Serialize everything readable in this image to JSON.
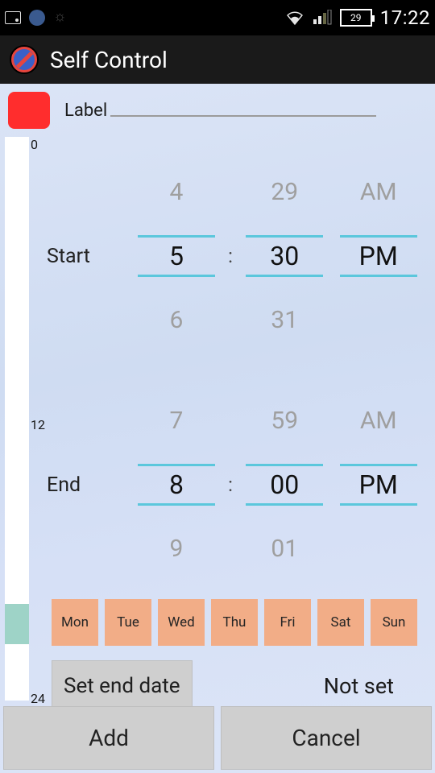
{
  "statusbar": {
    "battery": "29",
    "time": "17:22"
  },
  "appbar": {
    "title": "Self Control"
  },
  "label": {
    "title": "Label"
  },
  "timeline": {
    "ticks": {
      "top": "0",
      "mid": "12",
      "bottom": "24"
    }
  },
  "picker": {
    "start": {
      "label": "Start",
      "hour_prev": "4",
      "minute_prev": "29",
      "ampm_prev": "AM",
      "hour": "5",
      "minute": "30",
      "ampm": "PM",
      "hour_next": "6",
      "minute_next": "31"
    },
    "end": {
      "label": "End",
      "hour_prev": "7",
      "minute_prev": "59",
      "ampm_prev": "AM",
      "hour": "8",
      "minute": "00",
      "ampm": "PM",
      "hour_next": "9",
      "minute_next": "01"
    },
    "separator": ":"
  },
  "days": [
    "Mon",
    "Tue",
    "Wed",
    "Thu",
    "Fri",
    "Sat",
    "Sun"
  ],
  "enddate": {
    "button": "Set end date",
    "value": "Not set"
  },
  "buttons": {
    "add": "Add",
    "cancel": "Cancel"
  }
}
